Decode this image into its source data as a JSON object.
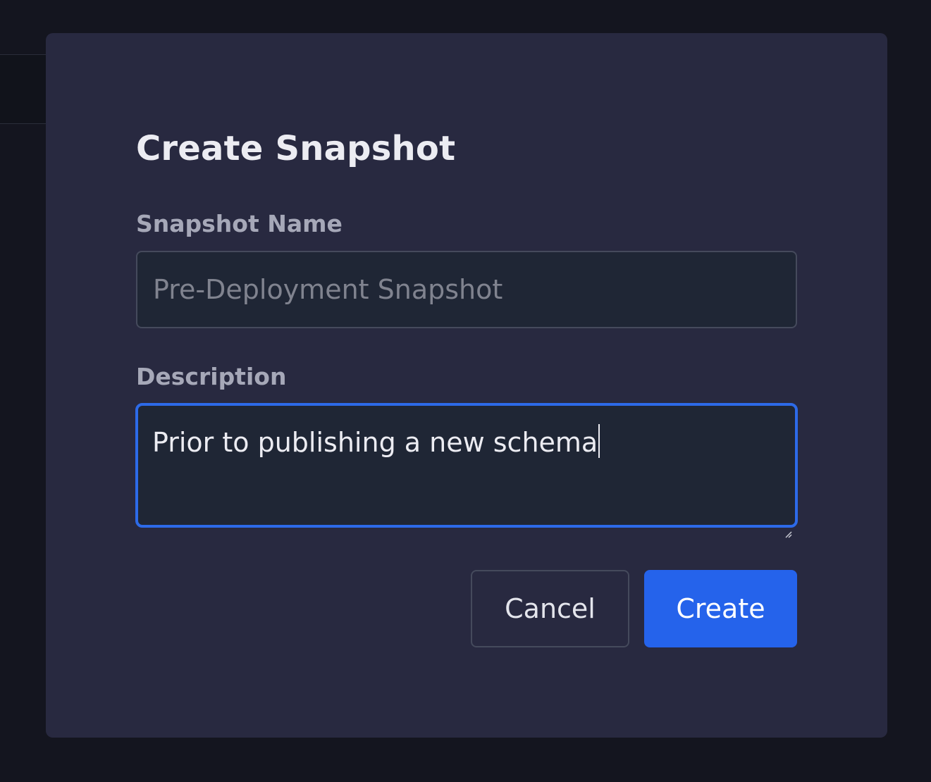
{
  "dialog": {
    "title": "Create Snapshot",
    "name_field": {
      "label": "Snapshot Name",
      "value": "",
      "placeholder": "Pre-Deployment Snapshot"
    },
    "description_field": {
      "label": "Description",
      "value": "Prior to publishing a new schema"
    },
    "buttons": {
      "cancel": "Cancel",
      "create": "Create"
    }
  },
  "colors": {
    "accent": "#2563eb",
    "modal_bg": "#282940",
    "input_bg": "#1f2635",
    "focus_border": "#2d6ae8"
  },
  "icons": [
    "resize-handle-icon"
  ]
}
